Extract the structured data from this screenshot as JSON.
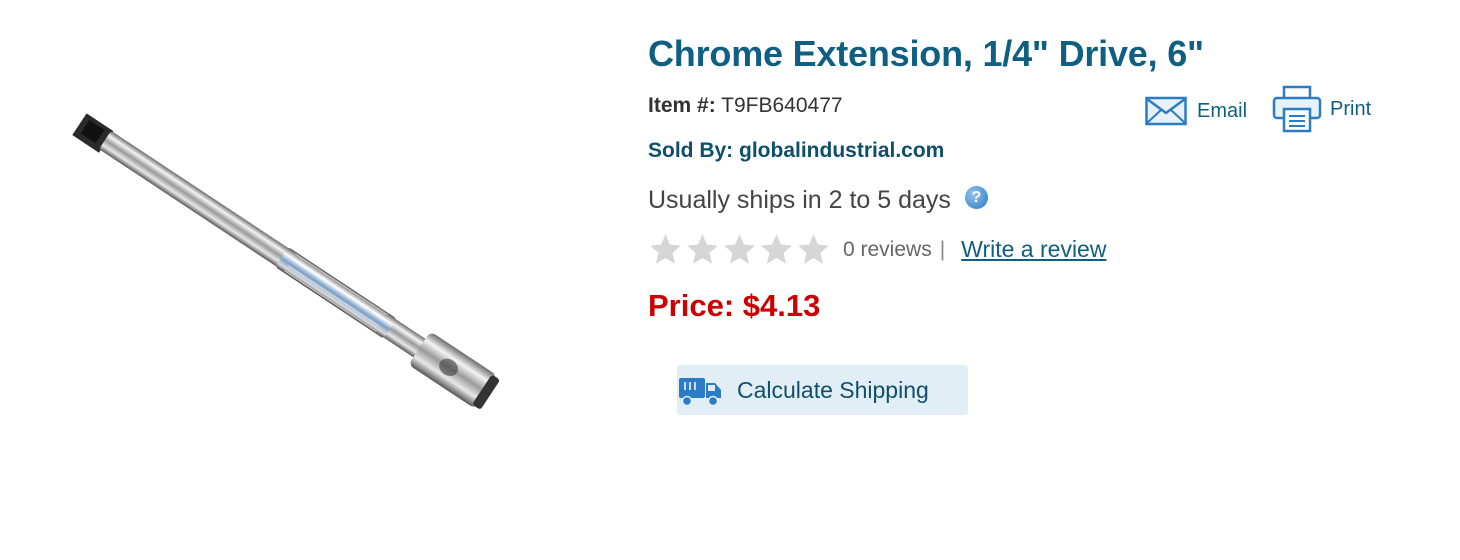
{
  "product": {
    "title": "Chrome Extension, 1/4\" Drive, 6\"",
    "item_label": "Item #:",
    "item_number": "T9FB640477",
    "sold_by": "Sold By: globalindustrial.com",
    "shipping_time": "Usually ships in 2 to 5 days",
    "rating_stars": 0,
    "reviews_text": "0 reviews",
    "separator": "|",
    "write_review": "Write a review",
    "price": "Price: $4.13",
    "image_icon": "socket-extension-image"
  },
  "actions": {
    "email_label": "Email",
    "print_label": "Print",
    "calculate_shipping_label": "Calculate Shipping"
  },
  "icons": {
    "help": "question-icon",
    "email": "envelope-icon",
    "print": "printer-icon",
    "truck": "truck-icon",
    "star": "star-icon"
  },
  "colors": {
    "title": "#0e5f82",
    "price": "#cc0000",
    "button_bg": "#e2eef5",
    "star_empty": "#d6d6d6"
  }
}
